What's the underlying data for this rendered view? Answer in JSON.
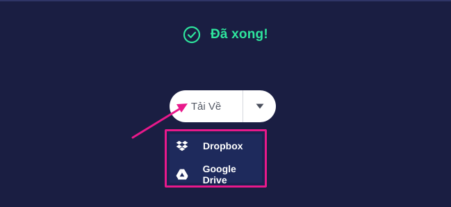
{
  "status": {
    "message": "Đã xong!",
    "icon": "check-circle-icon",
    "color": "#2ee59d"
  },
  "download": {
    "button_label": "Tải Về",
    "toggle_icon": "caret-down-icon"
  },
  "menu": {
    "items": [
      {
        "label": "Dropbox",
        "icon": "dropbox-icon"
      },
      {
        "label": "Google Drive",
        "icon": "google-drive-icon"
      }
    ],
    "highlight_color": "#e8198b"
  },
  "theme": {
    "background": "#1a1e42",
    "annotation_arrow": "#e8198b"
  }
}
